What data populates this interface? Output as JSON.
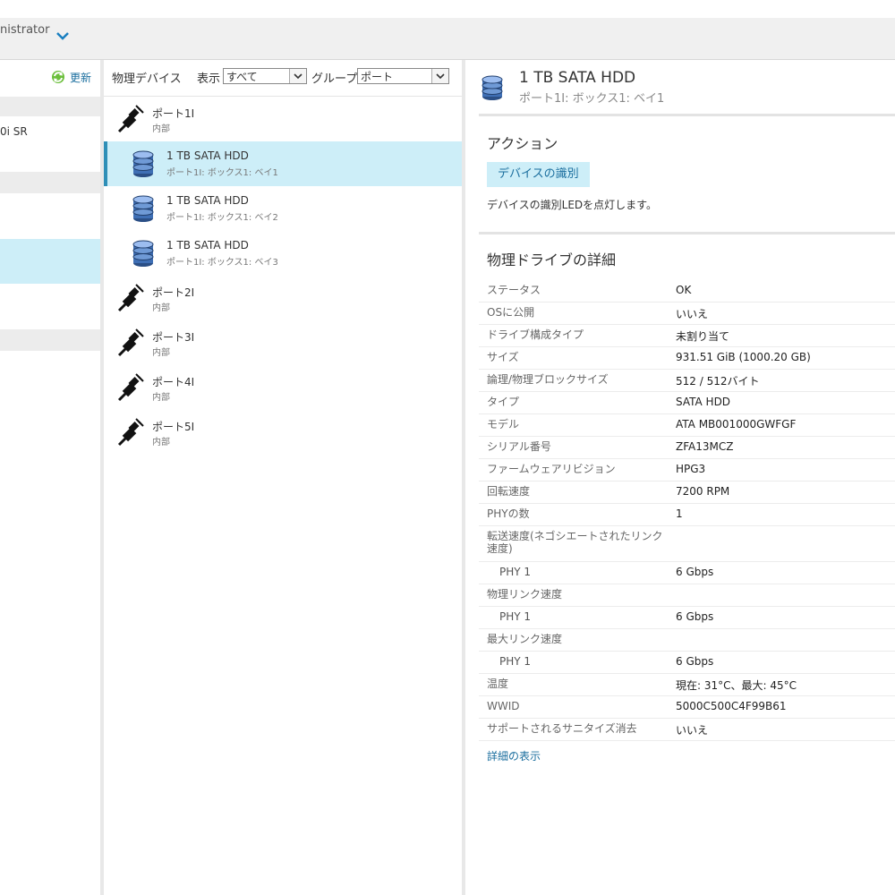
{
  "header": {
    "user_label": "nistrator"
  },
  "left_panel": {
    "refresh_label": "更新",
    "texts": [
      "0i SR"
    ]
  },
  "middle_panel": {
    "title": "物理デバイス",
    "view_label": "表示",
    "view_value": "すべて",
    "group_label": "グループ",
    "group_value": "ポート",
    "items": [
      {
        "kind": "port",
        "name": "ポート1I",
        "sub": "内部"
      },
      {
        "kind": "drive",
        "name": "1 TB SATA HDD",
        "sub": "ポート1I: ボックス1: ベイ1",
        "selected": true
      },
      {
        "kind": "drive",
        "name": "1 TB SATA HDD",
        "sub": "ポート1I: ボックス1: ベイ2"
      },
      {
        "kind": "drive",
        "name": "1 TB SATA HDD",
        "sub": "ポート1I: ボックス1: ベイ3"
      },
      {
        "kind": "port",
        "name": "ポート2I",
        "sub": "内部"
      },
      {
        "kind": "port",
        "name": "ポート3I",
        "sub": "内部"
      },
      {
        "kind": "port",
        "name": "ポート4I",
        "sub": "内部"
      },
      {
        "kind": "port",
        "name": "ポート5I",
        "sub": "内部"
      }
    ]
  },
  "right_panel": {
    "title": "1 TB SATA HDD",
    "subtitle": "ポート1I: ボックス1: ベイ1",
    "actions_heading": "アクション",
    "identify_button": "デバイスの識別",
    "identify_desc": "デバイスの識別LEDを点灯します。",
    "details_heading": "物理ドライブの詳細",
    "details": [
      {
        "key": "ステータス",
        "value": "OK"
      },
      {
        "key": "OSに公開",
        "value": "いいえ"
      },
      {
        "key": "ドライブ構成タイプ",
        "value": "未割り当て"
      },
      {
        "key": "サイズ",
        "value": "931.51 GiB (1000.20 GB)"
      },
      {
        "key": "論理/物理ブロックサイズ",
        "value": "512 / 512バイト"
      },
      {
        "key": "タイプ",
        "value": "SATA HDD"
      },
      {
        "key": "モデル",
        "value": "ATA MB001000GWFGF"
      },
      {
        "key": "シリアル番号",
        "value": "ZFA13MCZ"
      },
      {
        "key": "ファームウェアリビジョン",
        "value": "HPG3"
      },
      {
        "key": "回転速度",
        "value": "7200 RPM"
      },
      {
        "key": "PHYの数",
        "value": "1"
      },
      {
        "key": "転送速度(ネゴシエートされたリンク速度)",
        "value": "",
        "tall": true
      },
      {
        "key": "PHY 1",
        "value": "6 Gbps",
        "indent": true
      },
      {
        "key": "物理リンク速度",
        "value": ""
      },
      {
        "key": "PHY 1",
        "value": "6 Gbps",
        "indent": true
      },
      {
        "key": "最大リンク速度",
        "value": ""
      },
      {
        "key": "PHY 1",
        "value": "6 Gbps",
        "indent": true
      },
      {
        "key": "温度",
        "value": "現在: 31°C、最大: 45°C"
      },
      {
        "key": "WWID",
        "value": "5000C500C4F99B61"
      },
      {
        "key": "サポートされるサニタイズ消去",
        "value": "いいえ"
      }
    ],
    "more_link": "詳細の表示"
  },
  "colors": {
    "accent": "#1a6e9e",
    "selection": "#cdeef8",
    "selection_bar": "#2f8fb7"
  },
  "icons": {
    "port": "connector-plug-icon",
    "drive": "disk-drive-icon",
    "refresh": "refresh-icon",
    "expand": "chevron-down-icon"
  }
}
